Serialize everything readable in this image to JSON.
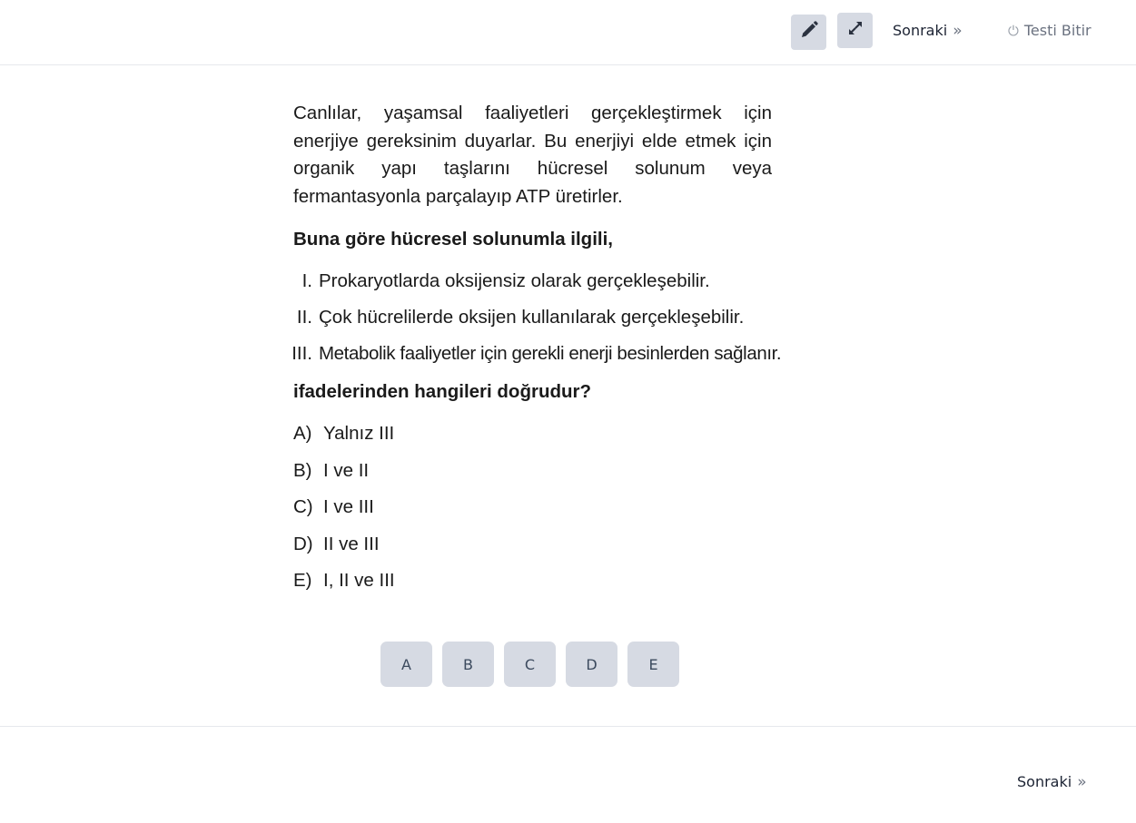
{
  "toolbar": {
    "pencil_icon": "pencil-icon",
    "expand_icon": "expand-icon",
    "next_label": "Sonraki",
    "finish_label": "Testi Bitir"
  },
  "question": {
    "stem": "Canlılar, yaşamsal faaliyetleri gerçekleştirmek için enerjiye gereksinim duyarlar. Bu enerjiyi elde etmek için organik yapı taşlarını hücresel solunum veya fermantasyonla parçalayıp ATP üretirler.",
    "prompt": "Buna göre hücresel solunumla ilgili,",
    "statements": [
      {
        "num": "I.",
        "text": "Prokaryotlarda oksijensiz olarak gerçekleşebilir."
      },
      {
        "num": "II.",
        "text": "Çok hücrelilerde oksijen kullanılarak gerçekleşebilir."
      },
      {
        "num": "III.",
        "text": "Metabolik faaliyetler için gerekli enerji besinlerden sağlanır."
      }
    ],
    "ask": "ifadelerinden hangileri doğrudur?",
    "options": [
      {
        "letter": "A)",
        "text": "Yalnız III"
      },
      {
        "letter": "B)",
        "text": "I ve II"
      },
      {
        "letter": "C)",
        "text": "I ve III"
      },
      {
        "letter": "D)",
        "text": "II ve III"
      },
      {
        "letter": "E)",
        "text": "I, II ve III"
      }
    ]
  },
  "answer_buttons": [
    "A",
    "B",
    "C",
    "D",
    "E"
  ],
  "footer": {
    "next_label": "Sonraki"
  },
  "colors": {
    "button_bg": "#d6dae3",
    "divider": "#e6e8ec",
    "text": "#1a1a1a"
  }
}
